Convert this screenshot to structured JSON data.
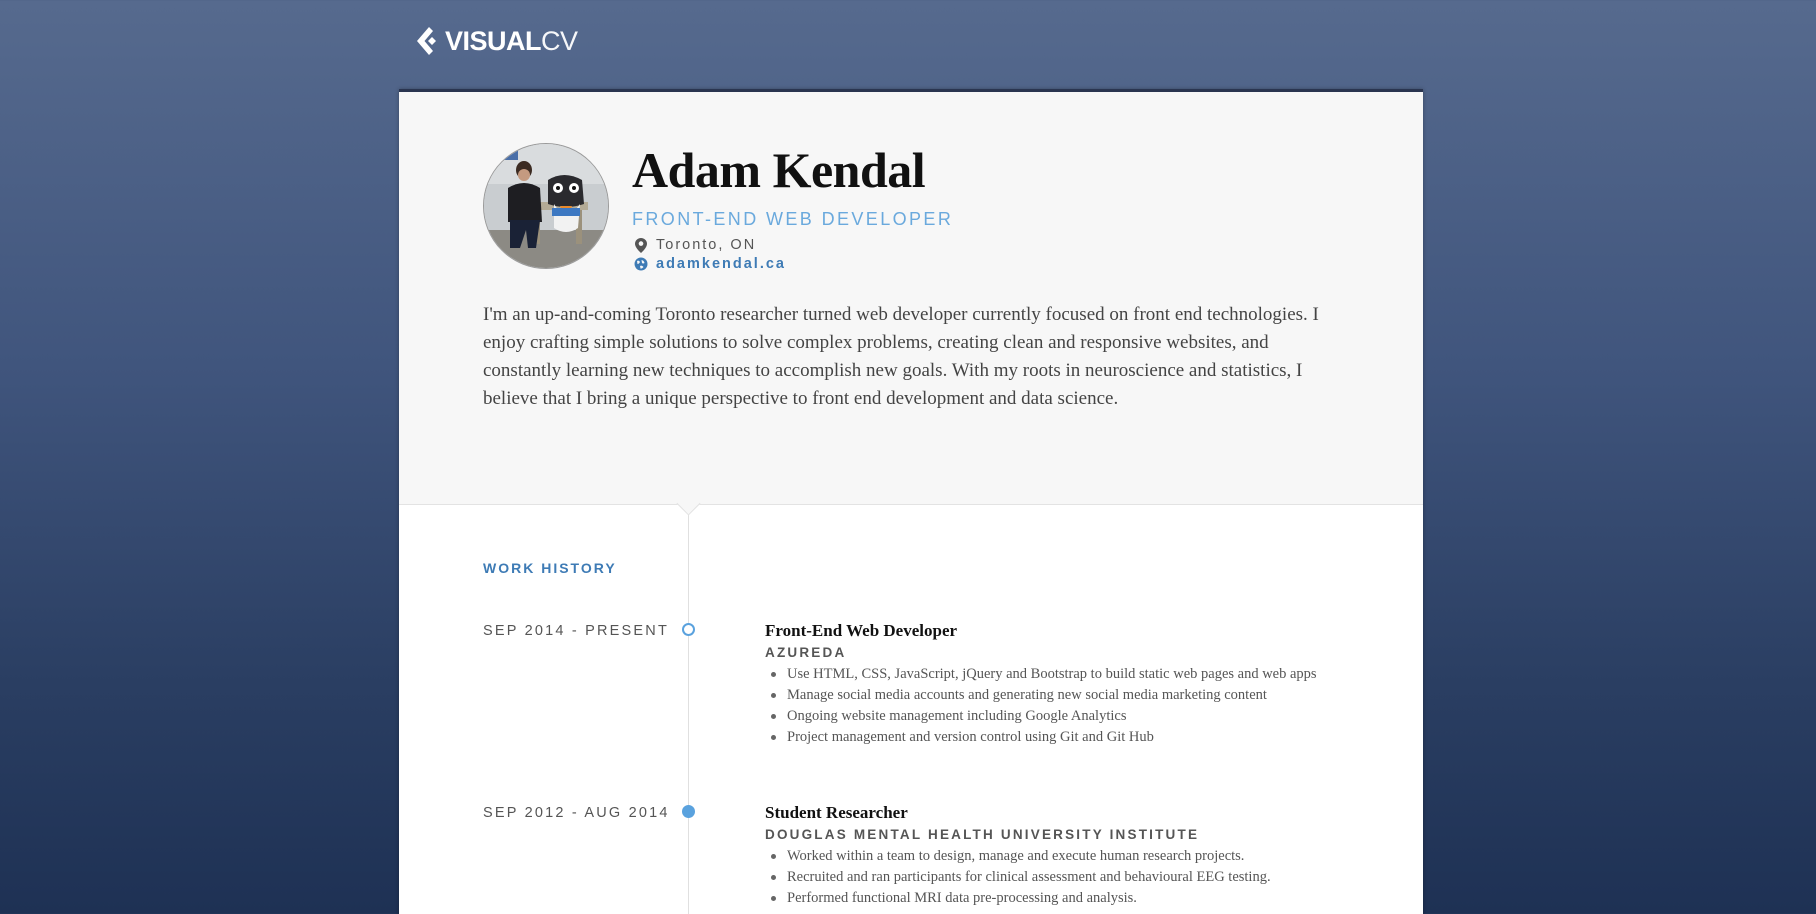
{
  "brand": {
    "logo_bold": "VISUAL",
    "logo_light": "CV"
  },
  "profile": {
    "name": "Adam Kendal",
    "title": "FRONT-END WEB DEVELOPER",
    "location": "Toronto, ON",
    "website": "adamkendal.ca",
    "bio": "I'm an up-and-coming Toronto researcher turned web developer currently focused on front end technologies. I enjoy crafting simple solutions to solve complex problems, creating clean and responsive websites, and constantly learning new techniques to accomplish new goals. With my roots in neuroscience and statistics, I believe that I bring a unique perspective to front end development and data science."
  },
  "work_history": {
    "section_title": "WORK HISTORY",
    "jobs": [
      {
        "dates": "SEP 2014 - PRESENT",
        "title": "Front-End Web Developer",
        "company": "AZUREDA",
        "bullets": [
          "Use HTML, CSS, JavaScript, jQuery and Bootstrap to build static web pages and web apps",
          "Manage social media accounts and generating new social media marketing content",
          "Ongoing website management including Google Analytics",
          "Project management and version control using Git and Git Hub"
        ]
      },
      {
        "dates": "SEP 2012 - AUG 2014",
        "title": "Student Researcher",
        "company": "DOUGLAS MENTAL HEALTH UNIVERSITY INSTITUTE",
        "bullets": [
          "Worked within a team to design, manage and execute human research projects.",
          "Recruited and ran participants for clinical assessment and behavioural EEG testing.",
          "Performed functional MRI data pre-processing and analysis."
        ]
      }
    ]
  },
  "colors": {
    "accent_blue": "#6aa9dd",
    "link_blue": "#3e7bb5",
    "timeline_dot": "#5aa2de",
    "page_bg_top": "#566a8e",
    "page_bg_bottom": "#1e3154"
  },
  "icons": {
    "logo": "visualcv-chevron-logo",
    "location": "map-pin-icon",
    "website": "globe-icon"
  }
}
